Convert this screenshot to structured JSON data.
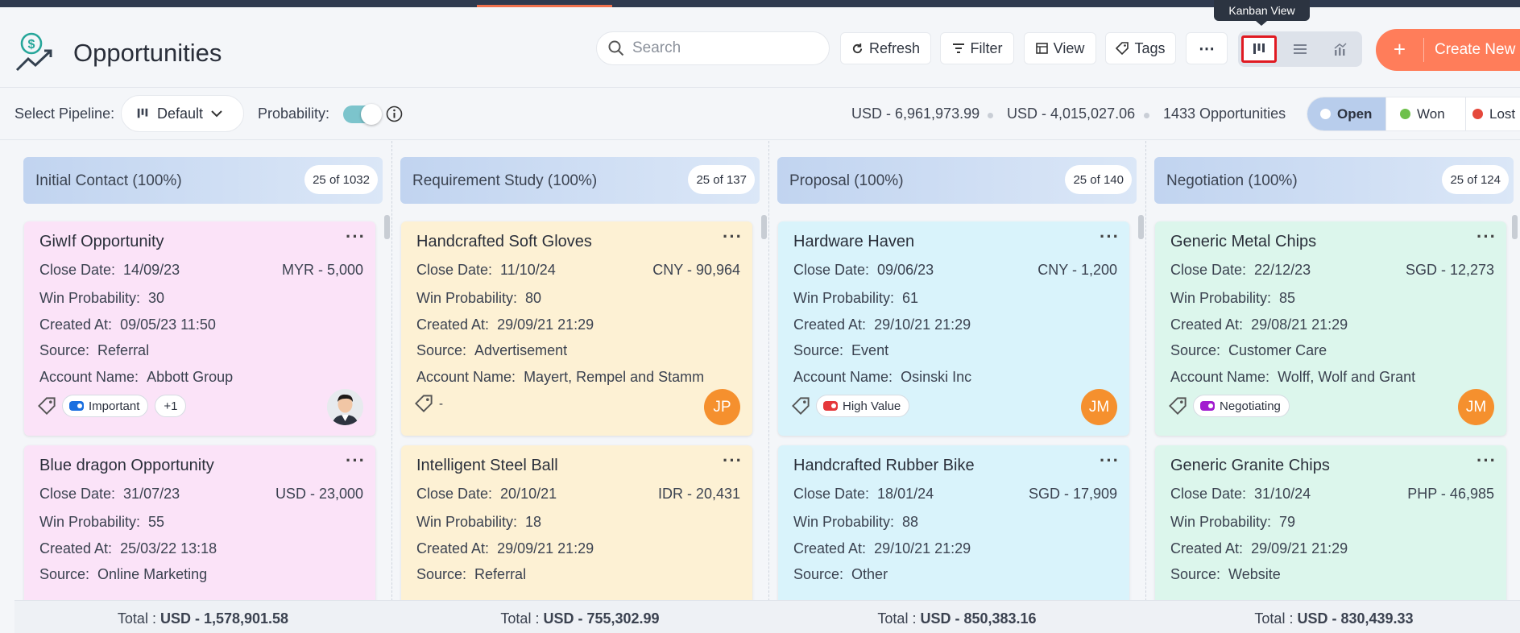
{
  "header": {
    "title": "Opportunities",
    "search_placeholder": "Search",
    "toolbar": {
      "refresh": "Refresh",
      "filter": "Filter",
      "view": "View",
      "tags": "Tags"
    },
    "tooltip": "Kanban View",
    "create_label": "Create New"
  },
  "subbar": {
    "pipeline_label": "Select Pipeline:",
    "pipeline_value": "Default",
    "probability_label": "Probability:",
    "probability_on": true,
    "stat_1": "USD - 6,961,973.99",
    "stat_2": "USD - 4,015,027.06",
    "stat_3": "1433 Opportunities",
    "statuses": [
      {
        "label": "Open",
        "color": "#ffffff"
      },
      {
        "label": "Won",
        "color": "#6ec04b"
      },
      {
        "label": "Lost",
        "color": "#e5483b"
      }
    ]
  },
  "columns": [
    {
      "title": "Initial Contact (100%)",
      "count": "25 of 1032",
      "total_prefix": "Total :",
      "total": "USD - 1,578,901.58",
      "cards": [
        {
          "title": "GiwIf Opportunity",
          "close_label": "Close Date:",
          "close": "14/09/23",
          "amount": "MYR - 5,000",
          "prob_label": "Win Probability:",
          "prob": "30",
          "created_label": "Created At:",
          "created": "09/05/23 11:50",
          "source_label": "Source:",
          "source": "Referral",
          "account_label": "Account Name:",
          "account": "Abbott Group",
          "tags": [
            "Important",
            "+1"
          ],
          "tag_color": "#1a6fe0",
          "avatar": ""
        },
        {
          "title": "Blue dragon Opportunity",
          "close_label": "Close Date:",
          "close": "31/07/23",
          "amount": "USD - 23,000",
          "prob_label": "Win Probability:",
          "prob": "55",
          "created_label": "Created At:",
          "created": "25/03/22 13:18",
          "source_label": "Source:",
          "source": "Online Marketing"
        }
      ]
    },
    {
      "title": "Requirement Study (100%)",
      "count": "25 of 137",
      "total_prefix": "Total :",
      "total": "USD - 755,302.99",
      "cards": [
        {
          "title": "Handcrafted Soft Gloves",
          "close_label": "Close Date:",
          "close": "11/10/24",
          "amount": "CNY - 90,964",
          "prob_label": "Win Probability:",
          "prob": "80",
          "created_label": "Created At:",
          "created": "29/09/21 21:29",
          "source_label": "Source:",
          "source": "Advertisement",
          "account_label": "Account Name:",
          "account": "Mayert, Rempel and Stamm",
          "tags": [
            "-"
          ],
          "tag_color": "",
          "avatar": "JP"
        },
        {
          "title": "Intelligent Steel Ball",
          "close_label": "Close Date:",
          "close": "20/10/21",
          "amount": "IDR - 20,431",
          "prob_label": "Win Probability:",
          "prob": "18",
          "created_label": "Created At:",
          "created": "29/09/21 21:29",
          "source_label": "Source:",
          "source": "Referral"
        }
      ]
    },
    {
      "title": "Proposal (100%)",
      "count": "25 of 140",
      "total_prefix": "Total :",
      "total": "USD - 850,383.16",
      "cards": [
        {
          "title": "Hardware Haven",
          "close_label": "Close Date:",
          "close": "09/06/23",
          "amount": "CNY - 1,200",
          "prob_label": "Win Probability:",
          "prob": "61",
          "created_label": "Created At:",
          "created": "29/10/21 21:29",
          "source_label": "Source:",
          "source": "Event",
          "account_label": "Account Name:",
          "account": "Osinski Inc",
          "tags": [
            "High Value"
          ],
          "tag_color": "#e5383b",
          "avatar": "JM"
        },
        {
          "title": "Handcrafted Rubber Bike",
          "close_label": "Close Date:",
          "close": "18/01/24",
          "amount": "SGD - 17,909",
          "prob_label": "Win Probability:",
          "prob": "88",
          "created_label": "Created At:",
          "created": "29/10/21 21:29",
          "source_label": "Source:",
          "source": "Other"
        }
      ]
    },
    {
      "title": "Negotiation (100%)",
      "count": "25 of 124",
      "total_prefix": "Total :",
      "total": "USD - 830,439.33",
      "cards": [
        {
          "title": "Generic Metal Chips",
          "close_label": "Close Date:",
          "close": "22/12/23",
          "amount": "SGD - 12,273",
          "prob_label": "Win Probability:",
          "prob": "85",
          "created_label": "Created At:",
          "created": "29/08/21 21:29",
          "source_label": "Source:",
          "source": "Customer Care",
          "account_label": "Account Name:",
          "account": "Wolff, Wolf and Grant",
          "tags": [
            "Negotiating"
          ],
          "tag_color": "#a21ccf",
          "avatar": "JM"
        },
        {
          "title": "Generic Granite Chips",
          "close_label": "Close Date:",
          "close": "31/10/24",
          "amount": "PHP - 46,985",
          "prob_label": "Win Probability:",
          "prob": "79",
          "created_label": "Created At:",
          "created": "29/09/21 21:29",
          "source_label": "Source:",
          "source": "Website"
        }
      ]
    }
  ],
  "colors": {
    "card_bg": [
      "#fbe3f8",
      "#fdf1d4",
      "#d9f3fb",
      "#dcf6ec"
    ],
    "accent": "#ff7d5a"
  }
}
